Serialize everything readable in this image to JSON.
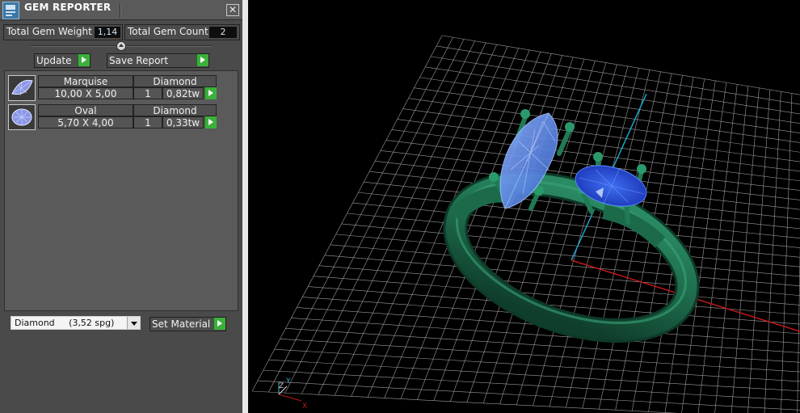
{
  "window": {
    "title": "GEM REPORTER"
  },
  "stats": {
    "weight_label": "Total Gem Weight",
    "weight_value": "1,14",
    "count_label": "Total Gem Count",
    "count_value": "2"
  },
  "actions": {
    "update_label": "Update",
    "save_report_label": "Save Report"
  },
  "gems": [
    {
      "shape": "Marquise",
      "type": "Diamond",
      "size": "10,00 X 5,00",
      "qty": "1",
      "weight": "0,82tw"
    },
    {
      "shape": "Oval",
      "type": "Diamond",
      "size": "5,70 X 4,00",
      "qty": "1",
      "weight": "0,33tw"
    }
  ],
  "material": {
    "selected": "Diamond     (3,52 spg)",
    "set_label": "Set Material"
  },
  "viewport": {
    "axes": {
      "z": "Z",
      "y": "Y",
      "x": "X"
    }
  },
  "colors": {
    "panel": "#4a4a4a",
    "go_button": "#3bb03b",
    "ring_metal": "#1f6b4e",
    "marquise_gem": "#5b86e0",
    "oval_gem": "#1f3fc0",
    "grid": "#bdbdbd",
    "axis_x": "#c01818",
    "axis_y": "#1aa6c8"
  },
  "icons": [
    "app-icon",
    "close-icon",
    "collapse-arrow-icon",
    "marquise-gem-icon",
    "oval-gem-icon",
    "dropdown-arrow-icon",
    "play-arrow-icon"
  ]
}
